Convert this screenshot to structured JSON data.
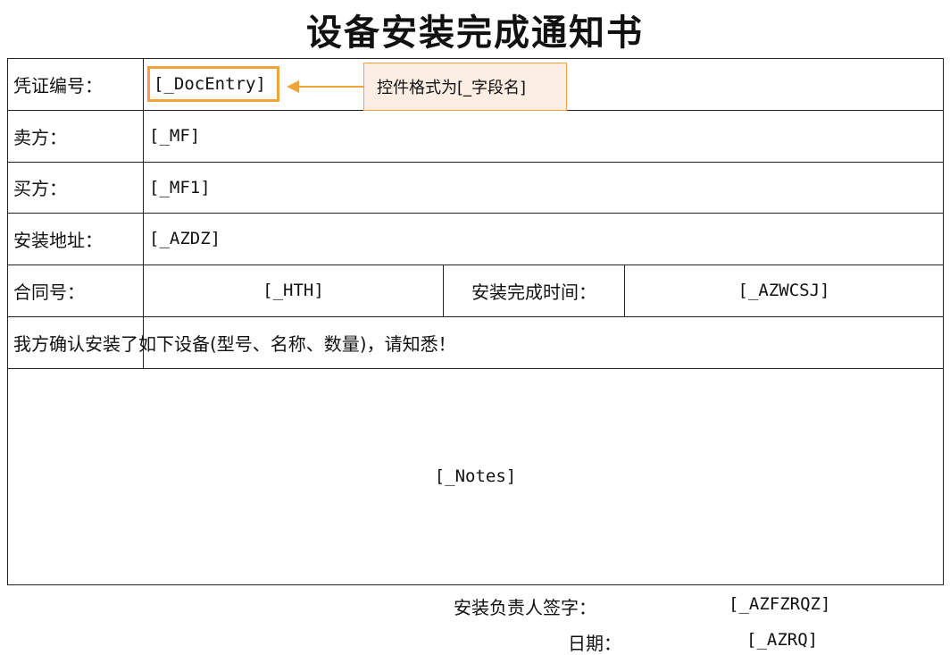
{
  "title": "设备安装完成通知书",
  "rows": {
    "voucher_label": "凭证编号：",
    "voucher_value": "[_DocEntry]",
    "seller_label": "卖方：",
    "seller_value": "[_MF]",
    "buyer_label": "买方：",
    "buyer_value": "[_MF1]",
    "address_label": "安装地址：",
    "address_value": "[_AZDZ]",
    "contract_label": "合同号：",
    "contract_value": "[_HTH]",
    "complete_time_label": "安装完成时间：",
    "complete_time_value": "[_AZWCSJ]",
    "confirm_text": "我方确认安装了如下设备(型号、名称、数量)，请知悉！",
    "notes_value": "[_Notes]"
  },
  "callout": {
    "text": "控件格式为[_字段名]",
    "accent_color": "#f2a33a",
    "fill_color": "#fdeee4"
  },
  "footer": {
    "signer_label": "安装负责人签字：",
    "signer_value": "[_AZFZRQZ]",
    "date_label": "日期：",
    "date_value": "[_AZRQ]"
  }
}
